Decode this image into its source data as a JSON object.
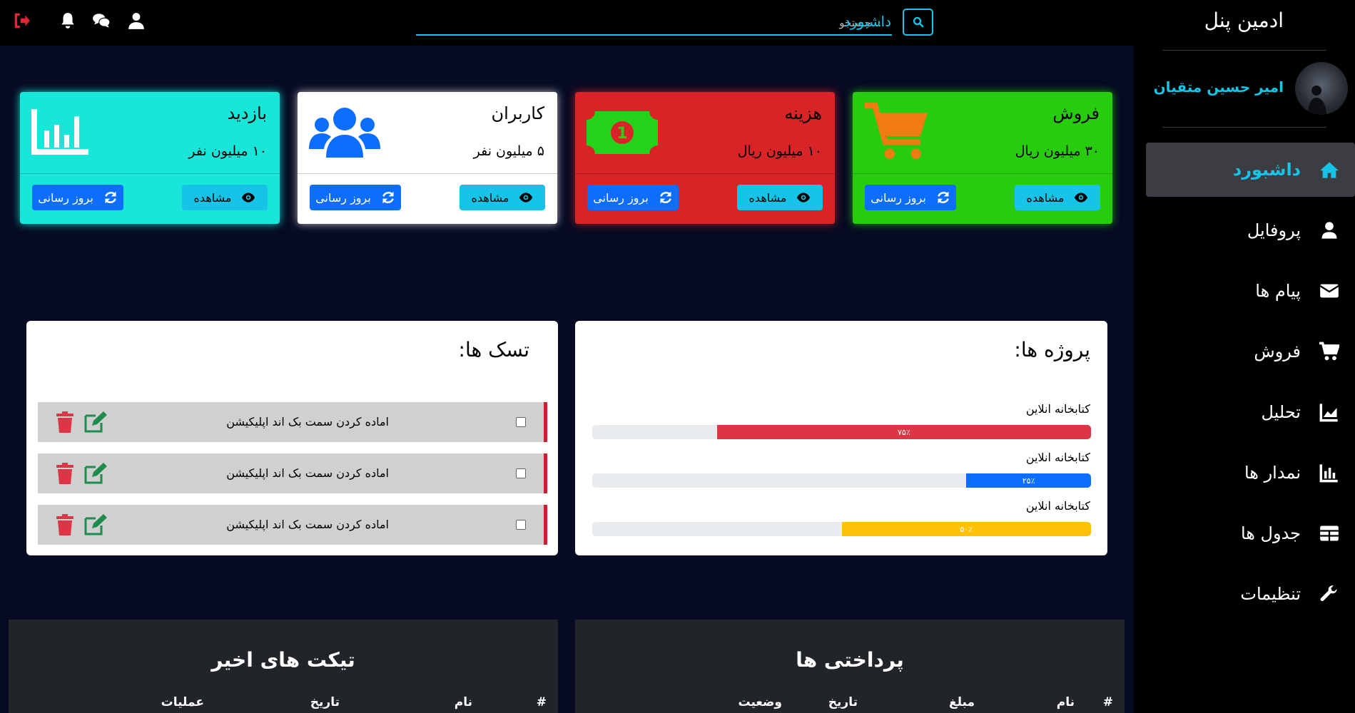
{
  "header": {
    "title": "داشبورد",
    "search_placeholder": "جستجو ...",
    "icons": [
      "logout-icon",
      "bell-icon",
      "comments-icon",
      "user-icon",
      "search-icon"
    ]
  },
  "sidebar": {
    "brand": "ادمین پنل",
    "user_name": "امیر حسین متقیان",
    "items": [
      {
        "label": "داشبورد",
        "icon": "home-icon",
        "active": true
      },
      {
        "label": "پروفایل",
        "icon": "user-icon",
        "active": false
      },
      {
        "label": "پیام ها",
        "icon": "envelope-icon",
        "active": false
      },
      {
        "label": "فروش",
        "icon": "cart-icon",
        "active": false
      },
      {
        "label": "تحلیل",
        "icon": "area-chart-icon",
        "active": false
      },
      {
        "label": "نمدار ها",
        "icon": "bar-chart-icon",
        "active": false
      },
      {
        "label": "جدول ها",
        "icon": "table-icon",
        "active": false
      },
      {
        "label": "تنظیمات",
        "icon": "wrench-icon",
        "active": false
      }
    ]
  },
  "cards": [
    {
      "title": "فروش",
      "value": "۳۰ میلیون ریال",
      "view": "مشاهده",
      "update": "بروز رسانی",
      "icon": "shopping-cart-icon",
      "bg": "#27cc0e",
      "icon_color": "#f07c11"
    },
    {
      "title": "هزینه",
      "value": "۱۰ میلیون ریال",
      "view": "مشاهده",
      "update": "بروز رسانی",
      "icon": "money-bill-icon",
      "bg": "#d82426",
      "icon_color": "#24d319",
      "money_digit": "1"
    },
    {
      "title": "کاربران",
      "value": "۵ میلیون نفر",
      "view": "مشاهده",
      "update": "بروز رسانی",
      "icon": "users-icon",
      "bg": "#ffffff",
      "icon_color": "#0d6efd"
    },
    {
      "title": "بازدید",
      "value": "۱۰ میلیون نفر",
      "view": "مشاهده",
      "update": "بروز رسانی",
      "icon": "bar-chart-icon",
      "bg": "#17e6d9",
      "icon_color": "#ffffff"
    }
  ],
  "projects": {
    "title": "پروژه ها:",
    "items": [
      {
        "label": "کتابخانه انلاین",
        "percent": 75,
        "percent_label": "۷۵٪",
        "color": "#dc3545"
      },
      {
        "label": "کتابخانه انلاین",
        "percent": 25,
        "percent_label": "۲۵٪",
        "color": "#0d6efd"
      },
      {
        "label": "کتابخانه انلاین",
        "percent": 50,
        "percent_label": "۵۰٪",
        "color": "#ffc107"
      }
    ]
  },
  "tasks": {
    "title": "تسک ها:",
    "items": [
      {
        "text": "اماده کردن سمت بک اند اپلیکیشن",
        "checked": false
      },
      {
        "text": "اماده کردن سمت بک اند اپلیکیشن",
        "checked": false
      },
      {
        "text": "اماده کردن سمت بک اند اپلیکیشن",
        "checked": false
      }
    ]
  },
  "payments": {
    "title": "پرداختی ها",
    "headers": [
      "#",
      "نام",
      "مبلغ",
      "تاریخ",
      "وضعیت"
    ]
  },
  "tickets": {
    "title": "تیکت های اخیر",
    "headers": [
      "#",
      "نام",
      "تاریخ",
      "عملیات"
    ]
  },
  "colors": {
    "accent": "#17c4e8",
    "background": "#060a22",
    "danger": "#dc3545",
    "primary": "#0d6efd"
  }
}
